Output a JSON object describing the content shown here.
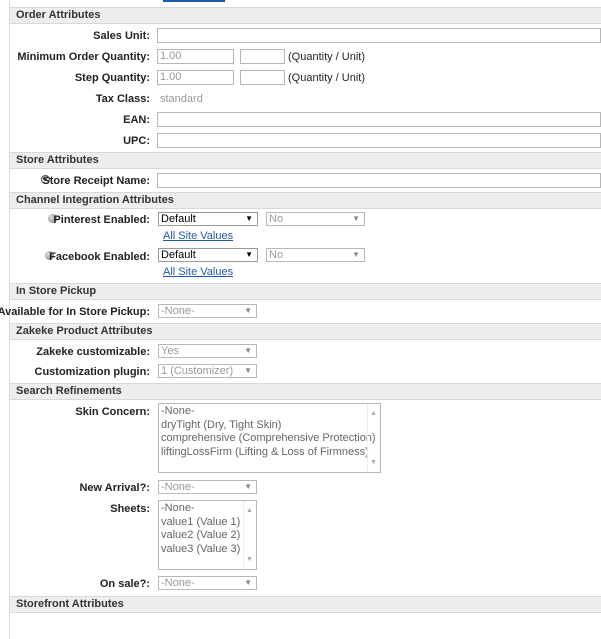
{
  "sections": {
    "order": "Order Attributes",
    "store": "Store Attributes",
    "channel": "Channel Integration Attributes",
    "pickup": "In Store Pickup",
    "zakeke": "Zakeke Product Attributes",
    "search": "Search Refinements",
    "storefront": "Storefront Attributes"
  },
  "order": {
    "sales_unit_label": "Sales Unit:",
    "sales_unit_value": "",
    "min_qty_label": "Minimum Order Quantity:",
    "min_qty_value": "1.00",
    "min_qty_unit_value": "",
    "min_qty_hint": "(Quantity / Unit)",
    "step_qty_label": "Step Quantity:",
    "step_qty_value": "1.00",
    "step_qty_unit_value": "",
    "step_qty_hint": "(Quantity / Unit)",
    "tax_label": "Tax Class:",
    "tax_value": "standard",
    "ean_label": "EAN:",
    "ean_value": "",
    "upc_label": "UPC:",
    "upc_value": ""
  },
  "store": {
    "receipt_label": "Store Receipt Name:",
    "receipt_value": ""
  },
  "channel": {
    "pinterest_label": "Pinterest Enabled:",
    "pinterest_select": "Default",
    "pinterest_value": "No",
    "pinterest_link": "All Site Values",
    "facebook_label": "Facebook Enabled:",
    "facebook_select": "Default",
    "facebook_value": "No",
    "facebook_link": "All Site Values"
  },
  "pickup": {
    "label": "Available for In Store Pickup:",
    "value": "-None-"
  },
  "zakeke": {
    "customizable_label": "Zakeke customizable:",
    "customizable_value": "Yes",
    "plugin_label": "Customization plugin:",
    "plugin_value": "1 (Customizer)"
  },
  "search": {
    "skin_label": "Skin Concern:",
    "skin_options": [
      "-None-",
      "dryTight (Dry, Tight Skin)",
      "comprehensive (Comprehensive Protection)",
      "liftingLossFirm (Lifting & Loss of Firmness)"
    ],
    "arrival_label": "New Arrival?:",
    "arrival_value": "-None-",
    "sheets_label": "Sheets:",
    "sheets_options": [
      "-None-",
      "value1 (Value 1)",
      "value2 (Value 2)",
      "value3 (Value 3)"
    ],
    "sale_label": "On sale?:",
    "sale_value": "-None-"
  },
  "icons": {
    "dropdown": "triangle-down",
    "scroll_up": "triangle-up",
    "scroll_down": "triangle-down",
    "localized": "globe",
    "channel": "dot"
  },
  "colors": {
    "link": "#1f5aa8",
    "section_bg": "#eeeeee"
  }
}
